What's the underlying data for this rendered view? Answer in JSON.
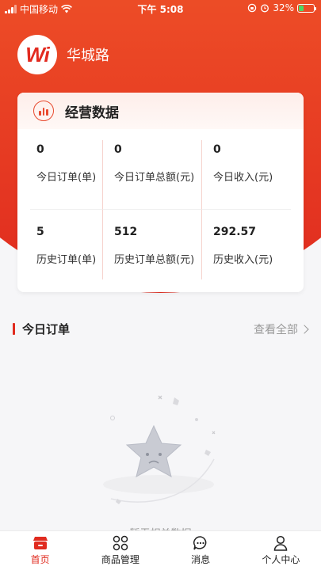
{
  "status_bar": {
    "carrier": "中国移动",
    "time": "下午 5:08",
    "battery": "32%",
    "battery_level": 0.32
  },
  "store": {
    "logo_text": "Wi",
    "name": "华城路"
  },
  "stats_card": {
    "title": "经营数据",
    "today": [
      {
        "value": "0",
        "label": "今日订单(单)"
      },
      {
        "value": "0",
        "label": "今日订单总额(元)"
      },
      {
        "value": "0",
        "label": "今日收入(元)"
      }
    ],
    "history": [
      {
        "value": "5",
        "label": "历史订单(单)"
      },
      {
        "value": "512",
        "label": "历史订单总额(元)"
      },
      {
        "value": "292.57",
        "label": "历史收入(元)"
      }
    ]
  },
  "orders_section": {
    "title": "今日订单",
    "view_all": "查看全部",
    "empty_text": "暂无相关数据"
  },
  "tabbar": {
    "items": [
      {
        "label": "首页",
        "icon": "home-icon",
        "active": true
      },
      {
        "label": "商品管理",
        "icon": "grid-icon",
        "active": false
      },
      {
        "label": "消息",
        "icon": "message-icon",
        "active": false
      },
      {
        "label": "个人中心",
        "icon": "person-icon",
        "active": false
      }
    ]
  },
  "colors": {
    "brand": "#e02b1f",
    "header_top": "#f0642c"
  }
}
